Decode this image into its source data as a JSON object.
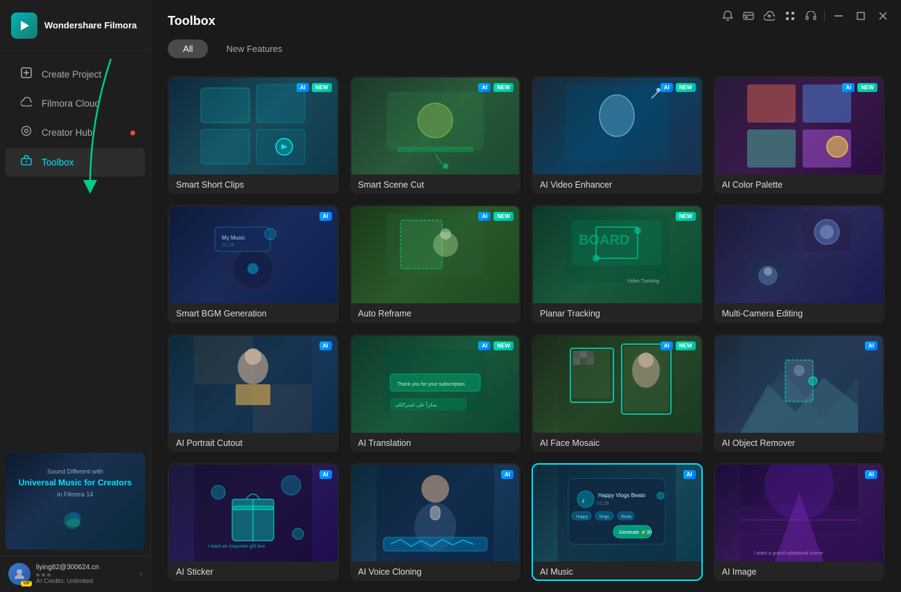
{
  "app": {
    "name": "Wondershare Filmora",
    "logo_char": "▶"
  },
  "titlebar": {
    "icons": [
      "notification",
      "subscription",
      "cloud",
      "apps",
      "headset"
    ],
    "window_buttons": [
      "minimize",
      "maximize",
      "close"
    ]
  },
  "sidebar": {
    "nav_items": [
      {
        "id": "create-project",
        "label": "Create Project",
        "icon": "⊕",
        "active": false
      },
      {
        "id": "filmora-cloud",
        "label": "Filmora Cloud",
        "icon": "☁",
        "active": false
      },
      {
        "id": "creator-hub",
        "label": "Creator Hub",
        "icon": "◎",
        "active": false,
        "has_dot": true
      },
      {
        "id": "toolbox",
        "label": "Toolbox",
        "icon": "⚙",
        "active": true
      }
    ],
    "banner": {
      "line1": "Sound Different with",
      "title": "Universal Music for Creators",
      "line3": "in Filmora 14"
    },
    "user": {
      "name": "liying82@300624.cn",
      "credits": "AI Credits: Unlimited",
      "avatar_char": "👤"
    }
  },
  "main": {
    "title": "Toolbox",
    "tabs": [
      {
        "id": "all",
        "label": "All",
        "active": true
      },
      {
        "id": "new-features",
        "label": "New Features",
        "active": false
      }
    ]
  },
  "tools": [
    {
      "id": "smart-short-clips",
      "label": "Smart Short Clips",
      "thumb_class": "thumb-smart-short",
      "icon": "✂",
      "badges": [
        "AI",
        "NEW"
      ]
    },
    {
      "id": "smart-scene-cut",
      "label": "Smart Scene Cut",
      "thumb_class": "thumb-smart-scene",
      "icon": "🎬",
      "badges": [
        "AI",
        "NEW"
      ]
    },
    {
      "id": "ai-video-enhancer",
      "label": "AI Video Enhancer",
      "thumb_class": "thumb-ai-video",
      "icon": "🎻",
      "badges": [
        "AI",
        "NEW"
      ]
    },
    {
      "id": "ai-color-palette",
      "label": "AI Color Palette",
      "thumb_class": "thumb-ai-color",
      "icon": "🎨",
      "badges": [
        "AI",
        "NEW"
      ]
    },
    {
      "id": "smart-bgm-generation",
      "label": "Smart BGM Generation",
      "thumb_class": "thumb-smart-bgm",
      "icon": "🎵",
      "badges": [
        "AI"
      ]
    },
    {
      "id": "auto-reframe",
      "label": "Auto Reframe",
      "thumb_class": "thumb-auto-reframe",
      "icon": "⬛",
      "badges": [
        "AI",
        "NEW"
      ]
    },
    {
      "id": "planar-tracking",
      "label": "Planar Tracking",
      "thumb_class": "thumb-planar",
      "icon": "📋",
      "badges": [
        "NEW"
      ]
    },
    {
      "id": "multi-camera-editing",
      "label": "Multi-Camera Editing",
      "thumb_class": "thumb-multi-cam",
      "icon": "📷",
      "badges": []
    },
    {
      "id": "ai-portrait-cutout",
      "label": "AI Portrait Cutout",
      "thumb_class": "thumb-portrait",
      "icon": "👤",
      "badges": [
        "AI"
      ]
    },
    {
      "id": "ai-translation",
      "label": "AI Translation",
      "thumb_class": "thumb-ai-trans",
      "icon": "💬",
      "badges": [
        "AI",
        "NEW"
      ]
    },
    {
      "id": "ai-face-mosaic",
      "label": "AI Face Mosaic",
      "thumb_class": "thumb-ai-face",
      "icon": "👥",
      "badges": [
        "AI",
        "NEW"
      ]
    },
    {
      "id": "ai-object-remover",
      "label": "AI Object Remover",
      "thumb_class": "thumb-ai-obj",
      "icon": "🏔",
      "badges": [
        "AI"
      ]
    },
    {
      "id": "ai-sticker",
      "label": "AI Sticker",
      "thumb_class": "thumb-ai-sticker",
      "icon": "🎁",
      "badges": [
        "AI"
      ]
    },
    {
      "id": "ai-voice-cloning",
      "label": "AI Voice Cloning",
      "thumb_class": "thumb-ai-voice",
      "icon": "🎤",
      "badges": [
        "AI"
      ]
    },
    {
      "id": "ai-music",
      "label": "AI Music",
      "thumb_class": "thumb-ai-music",
      "icon": "🎶",
      "badges": [
        "AI"
      ],
      "selected": true
    },
    {
      "id": "ai-image",
      "label": "AI Image",
      "thumb_class": "thumb-ai-image",
      "icon": "🖼",
      "badges": [
        "AI"
      ]
    }
  ]
}
